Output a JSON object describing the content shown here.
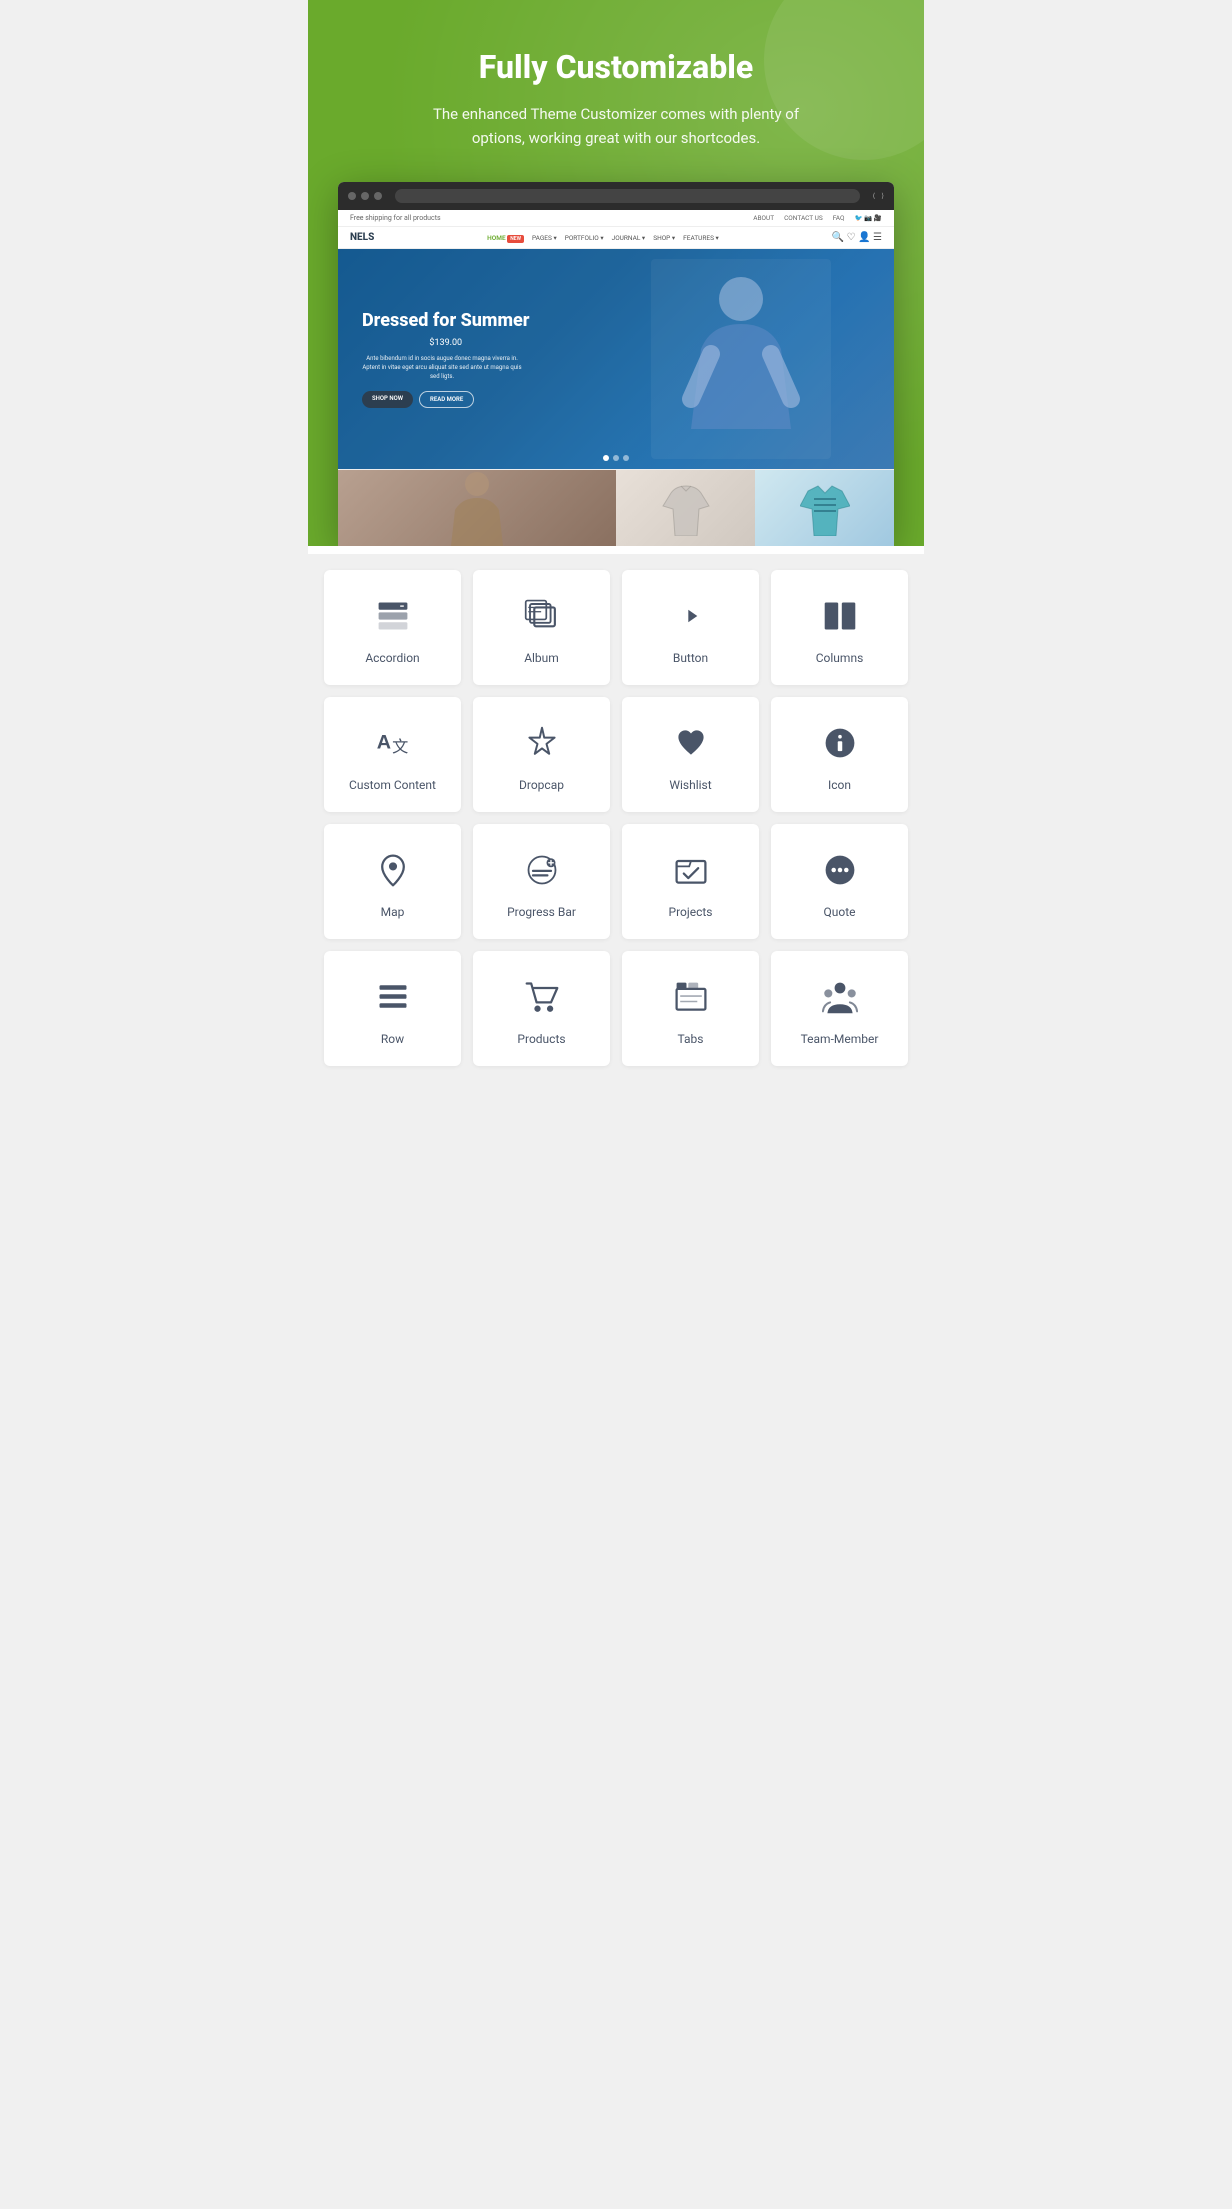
{
  "hero": {
    "title": "Fully Customizable",
    "subtitle": "The enhanced Theme Customizer comes with plenty of options, working great with our shortcodes."
  },
  "mockup": {
    "shipping_text": "Free shipping for all products",
    "logo": "NELS",
    "nav_items": [
      "HOME",
      "PAGES",
      "PORTFOLIO",
      "JOURNAL",
      "SHOP",
      "FEATURES"
    ],
    "nav_about": "ABOUT",
    "nav_contact": "CONTACT US",
    "nav_faq": "FAQ",
    "hero_title": "Dressed for Summer",
    "hero_price": "$139.00",
    "hero_desc": "Ante bibendum id in socis augue donec magna viverra in. Aptent in vitae eget arcu aliquat site sed ante ut magna quis sed ligts.",
    "btn_shop": "SHOP NOW",
    "btn_read": "READ MORE"
  },
  "features": [
    {
      "id": "accordion",
      "label": "Accordion",
      "icon": "accordion"
    },
    {
      "id": "album",
      "label": "Album",
      "icon": "album"
    },
    {
      "id": "button",
      "label": "Button",
      "icon": "button"
    },
    {
      "id": "columns",
      "label": "Columns",
      "icon": "columns"
    },
    {
      "id": "custom-content",
      "label": "Custom Content",
      "icon": "custom-content"
    },
    {
      "id": "dropcap",
      "label": "Dropcap",
      "icon": "dropcap"
    },
    {
      "id": "wishlist",
      "label": "Wishlist",
      "icon": "wishlist"
    },
    {
      "id": "icon",
      "label": "Icon",
      "icon": "icon"
    },
    {
      "id": "map",
      "label": "Map",
      "icon": "map"
    },
    {
      "id": "progress-bar",
      "label": "Progress Bar",
      "icon": "progress-bar"
    },
    {
      "id": "projects",
      "label": "Projects",
      "icon": "projects"
    },
    {
      "id": "quote",
      "label": "Quote",
      "icon": "quote"
    },
    {
      "id": "row",
      "label": "Row",
      "icon": "row"
    },
    {
      "id": "products",
      "label": "Products",
      "icon": "products"
    },
    {
      "id": "tabs",
      "label": "Tabs",
      "icon": "tabs"
    },
    {
      "id": "team-member",
      "label": "Team-Member",
      "icon": "team-member"
    }
  ]
}
